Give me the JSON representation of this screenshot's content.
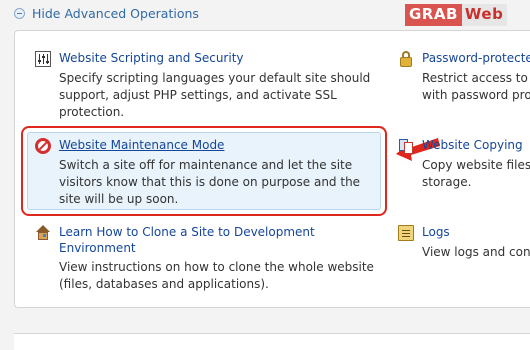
{
  "toggle": {
    "label": "Hide Advanced Operations"
  },
  "watermark": {
    "part1": "GRAB",
    "part2": "Web"
  },
  "items": {
    "scripting": {
      "title": "Website Scripting and Security",
      "desc": [
        "Specify scripting languages your default site should",
        "support, adjust PHP settings, and activate SSL",
        "protection."
      ]
    },
    "password": {
      "title": "Password-protecte",
      "desc": [
        "Restrict access to s",
        "with password protc"
      ]
    },
    "maintenance": {
      "title": "Website Maintenance Mode",
      "desc": [
        "Switch a site off for maintenance and let the site",
        "visitors know that this is done on purpose and the",
        "site will be up soon."
      ]
    },
    "copying": {
      "title": "Website Copying",
      "desc": [
        "Copy website files",
        "storage."
      ]
    },
    "clone": {
      "title": [
        "Learn How to Clone a Site to Development",
        "Environment"
      ],
      "desc": [
        "View instructions on how to clone the whole website",
        "(files, databases and applications)."
      ]
    },
    "logs": {
      "title": "Logs",
      "desc": [
        "View logs and conf"
      ]
    }
  },
  "colors": {
    "link": "#15469a",
    "highlight": "#e0271d",
    "accent_red": "#d9534f"
  }
}
